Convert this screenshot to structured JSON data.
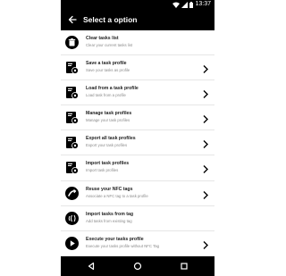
{
  "status_bar": {
    "time": "13:37",
    "icons": [
      "wifi-icon",
      "signal-icon",
      "battery-icon"
    ]
  },
  "app_bar": {
    "title": "Select a option",
    "back_icon": "back-arrow-icon"
  },
  "options": [
    {
      "title": "Clear tasks list",
      "subtitle": "Clear your current tasks list",
      "icon": "trash-icon",
      "has_chevron": false
    },
    {
      "title": "Save a task profile",
      "subtitle": "Save your tasks as profile",
      "icon": "profile-gear-icon",
      "has_chevron": true
    },
    {
      "title": "Load from a task profile",
      "subtitle": "Load task from a profile",
      "icon": "profile-gear-icon",
      "has_chevron": true
    },
    {
      "title": "Manage task profiles",
      "subtitle": "Manage your task profiles",
      "icon": "profile-gear-icon",
      "has_chevron": true
    },
    {
      "title": "Export all task profiles",
      "subtitle": "Export your task profiles",
      "icon": "profile-gear-icon",
      "has_chevron": true
    },
    {
      "title": "Import task profiles",
      "subtitle": "Import task profiles",
      "icon": "profile-gear-icon",
      "has_chevron": true
    },
    {
      "title": "Reuse your NFC tags",
      "subtitle": "Associate a NFC tag to a task profile",
      "icon": "nfc-reuse-icon",
      "has_chevron": true
    },
    {
      "title": "Import tasks from tag",
      "subtitle": "Add tasks from existing tag",
      "icon": "nfc-import-icon",
      "has_chevron": false
    },
    {
      "title": "Execute your tasks profile",
      "subtitle": "Execute your tasks profile without NFC Tag",
      "icon": "play-icon",
      "has_chevron": true
    }
  ],
  "nav_bar": {
    "buttons": [
      "nav-back-icon",
      "nav-home-icon",
      "nav-recents-icon"
    ]
  },
  "colors": {
    "bar_background": "#000000",
    "title_text": "#222222",
    "subtitle_text": "#8a8a8a"
  }
}
